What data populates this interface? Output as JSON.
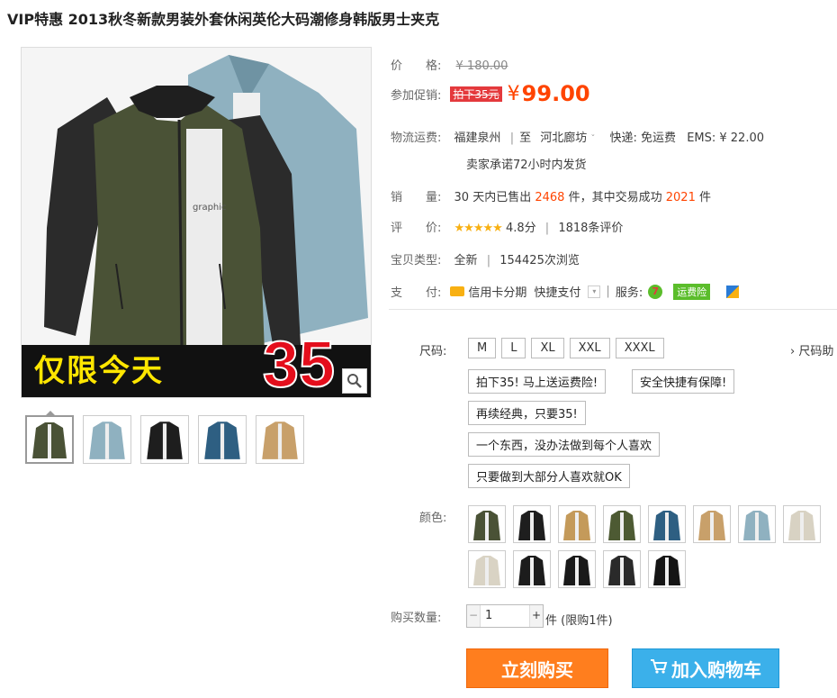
{
  "product": {
    "title": "VIP特惠 2013秋冬新款男装外套休闲英伦大码潮修身韩版男士夹克",
    "image_banner_text": "仅限今天",
    "image_banner_number": "35"
  },
  "price": {
    "label": "价　　格:",
    "original": "¥ 180.00",
    "promo_label": "参加促销:",
    "promo_tag": "拍下35元",
    "currency": "¥",
    "current": "99.00"
  },
  "shipping": {
    "label": "物流运费:",
    "from": "福建泉州",
    "to_word": "至",
    "to": "河北廊坊",
    "express": "快递: 免运费",
    "ems": "EMS: ¥ 22.00",
    "promise": "卖家承诺72小时内发货"
  },
  "sales": {
    "label": "销　　量:",
    "text_a": "30 天内已售出",
    "sold": "2468",
    "text_b": "件，其中交易成功",
    "success": "2021",
    "text_c": "件"
  },
  "rating": {
    "label": "评　　价:",
    "stars": "★★★★★",
    "score": "4.8分",
    "reviews": "1818条评价"
  },
  "type": {
    "label": "宝贝类型:",
    "value": "全新",
    "views": "154425次浏览"
  },
  "payment": {
    "label": "支　　付:",
    "credit": "信用卡分期",
    "quick": "快捷支付",
    "service_label": "服务:",
    "insurance": "运费险"
  },
  "size": {
    "label": "尺码:",
    "options": [
      "M",
      "L",
      "XL",
      "XXL",
      "XXXL"
    ],
    "chart_link": "› 尺码助"
  },
  "style_options": [
    "拍下35! 马上送运费险!",
    "安全快捷有保障!",
    "再续经典，只要35!",
    "一个东西，没办法做到每个人喜欢",
    "只要做到大部分人喜欢就OK"
  ],
  "color": {
    "label": "颜色:",
    "swatches": [
      "#4a5236",
      "#1e1e1e",
      "#c49a5a",
      "#4d5a33",
      "#2e5f82",
      "#c8a06a",
      "#8fb1c0",
      "#d8d2c3",
      "#d9d3c4",
      "#1c1c1c",
      "#1a1a1a",
      "#2a2a2a",
      "#151515"
    ]
  },
  "quantity": {
    "label": "购买数量:",
    "value": "1",
    "minus": "−",
    "plus": "+",
    "unit": "件 (限购1件)"
  },
  "buttons": {
    "buy": "立刻购买",
    "cart": "加入购物车"
  },
  "thumbnails": [
    "green-jacket",
    "blue-jacket",
    "black-jacket",
    "navy-jacket",
    "khaki-jacket"
  ],
  "thumb_colors": [
    "#4a5236",
    "#8fb1c0",
    "#1e1e1e",
    "#2e5f82",
    "#c8a06a"
  ]
}
